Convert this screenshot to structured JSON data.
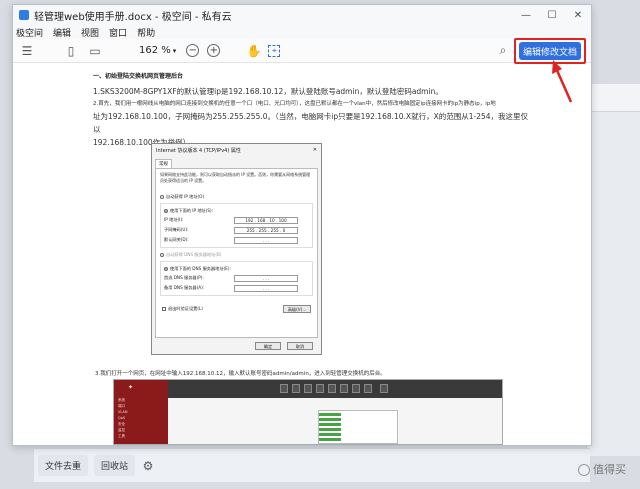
{
  "window": {
    "title": "轻管理web使用手册.docx - 极空间 - 私有云"
  },
  "menu": [
    "极空间",
    "编辑",
    "视图",
    "窗口",
    "帮助"
  ],
  "toolbar": {
    "zoom": "162 %",
    "edit_label": "编辑修改文档"
  },
  "doc": {
    "heading": "一、初始登陆交换机网页管理后台",
    "line1": "1.SKS3200M-8GPY1XF的默认管理ip是192.168.10.12，默认登陆账号admin，默认登陆密码admin。",
    "line2": "2.首先，我们用一根网线从电脑的网口连接到交换机的任意一个口（电口、光口均可），这盘已默认都在一个vlan中，然后修改电脑固定ip连接网卡的ip为静态ip，ip地",
    "line3": "址为192.168.10.100，子网掩码为255.255.255.0。（当然，电脑网卡ip只要是192.168.10.X就行，X的范围从1-254，我这里仅以",
    "line4": "192.168.10.100作为举例）。",
    "line5": "3.我们打开一个网页，在网址中输入192.168.10.12，输入默认账号密码admin/admin，进入到轻管理交换机的后台。"
  },
  "dialog": {
    "title": "Internet 协议版本 4 (TCP/IPv4) 属性",
    "tab": "常规",
    "desc": "如果网络支持此功能，则可以获取自动指派的 IP 设置。否则，你需要从网络系统管理员处获得适当的 IP 设置。",
    "auto_ip": "自动获得 IP 地址(O)",
    "manual_ip": "使用下面的 IP 地址(S):",
    "ip_label": "IP 地址(I):",
    "ip_value": "192 . 168 . 10 . 100",
    "mask_label": "子网掩码(U):",
    "mask_value": "255 . 255 . 255 . 0",
    "gw_label": "默认网关(D):",
    "gw_value": ".       .       .",
    "auto_dns": "自动获得 DNS 服务器地址(B)",
    "manual_dns": "使用下面的 DNS 服务器地址(E):",
    "dns1_label": "首选 DNS 服务器(P):",
    "dns2_label": "备用 DNS 服务器(A):",
    "dns_value": ".       .       .",
    "validate": "退出时验证设置(L)",
    "advanced": "高级(V)...",
    "ok": "确定",
    "cancel": "取消"
  },
  "switch_ui": {
    "nav": [
      "系统",
      "端口",
      "VLAN",
      "QoS",
      "安全",
      "监控",
      "工具"
    ]
  },
  "bottom": {
    "dedup": "文件去重",
    "recycle": "回收站"
  },
  "watermark": "值得买",
  "colors": {
    "accent": "#2f6fe0",
    "highlight": "#e02222"
  }
}
